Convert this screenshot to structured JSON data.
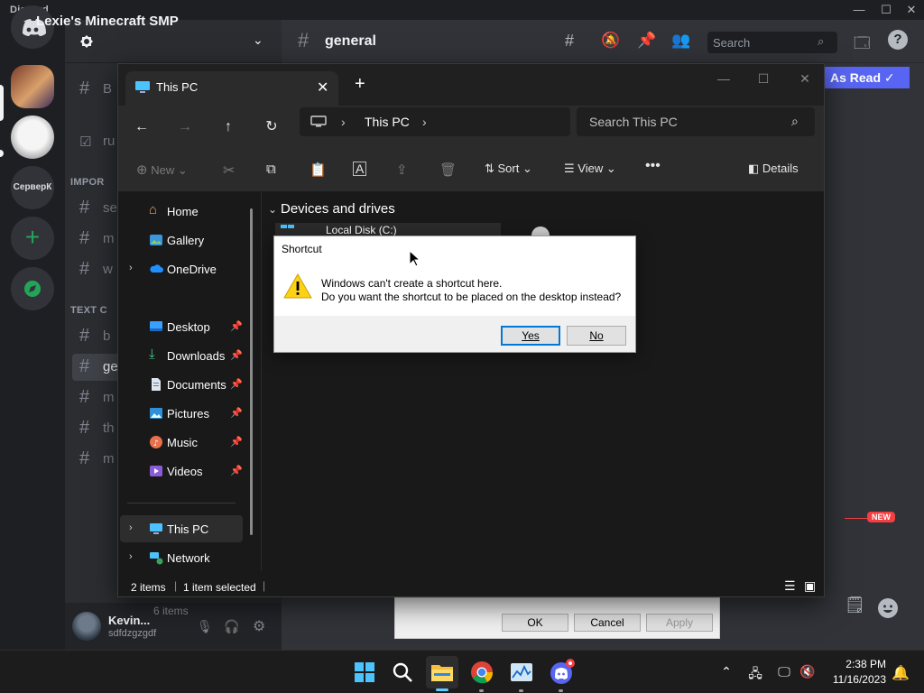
{
  "discord": {
    "app_name": "Discord",
    "server_name": "Lexie's Minecraft SMP",
    "channel_name": "general",
    "search_placeholder": "Search",
    "mark_as_read": "As Read",
    "new_badge": "NEW",
    "server_short": "СерверК",
    "categories": [
      "IMPOR",
      "TEXT C"
    ],
    "channels": [
      "B",
      "ru",
      "se",
      "m",
      "w",
      "b",
      "ge",
      "m",
      "th",
      "m"
    ],
    "user": {
      "name": "Kevin...",
      "tag": "sdfdzgzgdf"
    }
  },
  "properties_dialog": {
    "items_text": "6 items",
    "ok": "OK",
    "cancel": "Cancel",
    "apply": "Apply"
  },
  "explorer": {
    "tab_title": "This PC",
    "address": "This PC",
    "search_placeholder": "Search This PC",
    "toolbar": {
      "new": "New",
      "sort": "Sort",
      "view": "View",
      "details": "Details"
    },
    "section": "Devices and drives",
    "drive_label": "Local Disk (C:)",
    "nav": {
      "home": "Home",
      "gallery": "Gallery",
      "onedrive": "OneDrive",
      "desktop": "Desktop",
      "downloads": "Downloads",
      "documents": "Documents",
      "pictures": "Pictures",
      "music": "Music",
      "videos": "Videos",
      "thispc": "This PC",
      "network": "Network"
    },
    "status": {
      "items": "2 items",
      "selected": "1 item selected"
    }
  },
  "dialog": {
    "title": "Shortcut",
    "line1": "Windows can't create a shortcut here.",
    "line2": "Do you want the shortcut to be placed on the desktop instead?",
    "yes": "Yes",
    "no": "No"
  },
  "taskbar": {
    "time": "2:38 PM",
    "date": "11/16/2023"
  },
  "colors": {
    "discord_blurple": "#5865f2",
    "accent": "#0078d7",
    "explorer_bg": "#191919"
  }
}
